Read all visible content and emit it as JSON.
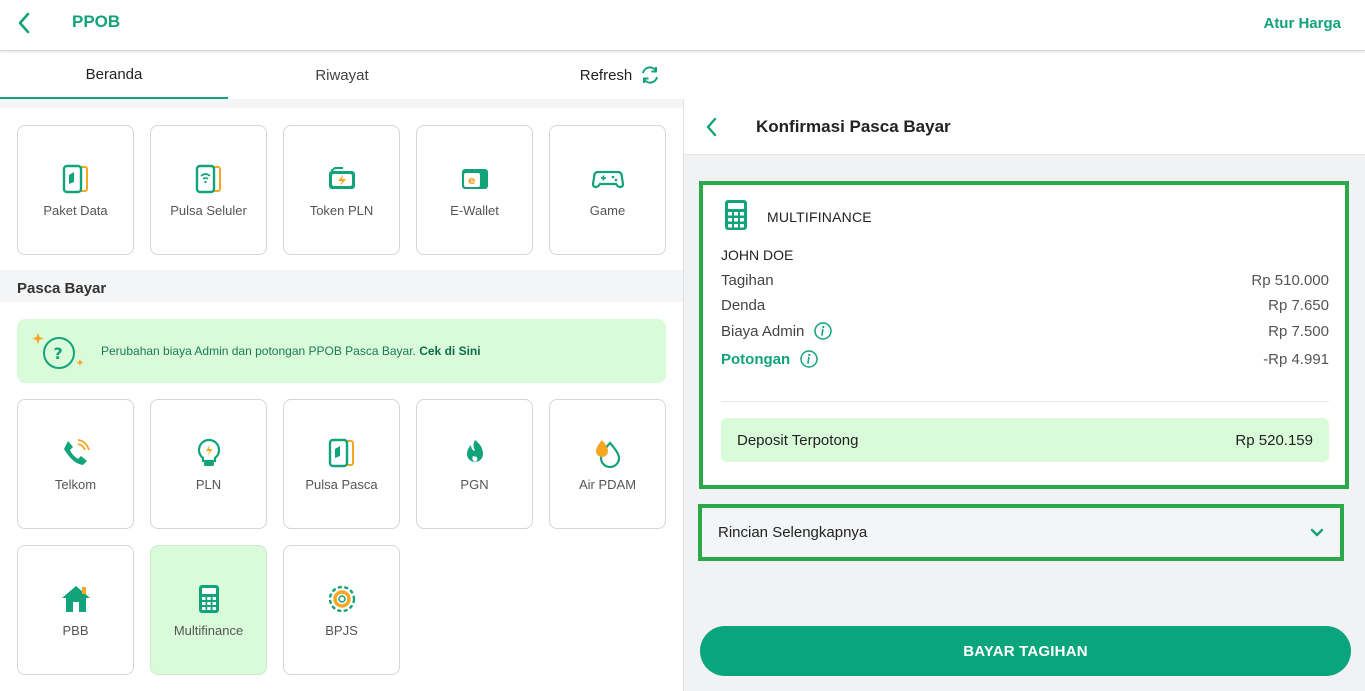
{
  "app": {
    "title": "PPOB",
    "action_label": "Atur Harga"
  },
  "tabs": [
    {
      "label": "Beranda",
      "active": true
    },
    {
      "label": "Riwayat",
      "active": false
    },
    {
      "label": "Refresh",
      "active": false
    }
  ],
  "prabayar": {
    "tiles": [
      {
        "label": "Paket Data",
        "icon": "paket-data-icon"
      },
      {
        "label": "Pulsa Seluler",
        "icon": "pulsa-seluler-icon"
      },
      {
        "label": "Token PLN",
        "icon": "token-pln-icon"
      },
      {
        "label": "E-Wallet",
        "icon": "e-wallet-icon"
      },
      {
        "label": "Game",
        "icon": "game-icon"
      }
    ]
  },
  "pascabayar": {
    "section_title": "Pasca Bayar",
    "banner": {
      "text": "Perubahan biaya Admin dan potongan PPOB Pasca Bayar. ",
      "link": "Cek di Sini"
    },
    "tiles": [
      {
        "label": "Telkom",
        "icon": "phone-icon"
      },
      {
        "label": "PLN",
        "icon": "lightbulb-icon"
      },
      {
        "label": "Pulsa Pasca",
        "icon": "pulsa-pasca-icon"
      },
      {
        "label": "PGN",
        "icon": "gas-icon"
      },
      {
        "label": "Air PDAM",
        "icon": "water-drop-icon"
      },
      {
        "label": "PBB",
        "icon": "house-icon"
      },
      {
        "label": "Multifinance",
        "icon": "calculator-icon",
        "selected": true
      },
      {
        "label": "BPJS",
        "icon": "bpjs-icon"
      }
    ]
  },
  "confirm": {
    "title": "Konfirmasi Pasca Bayar",
    "product": "MULTIFINANCE",
    "customer_name": "JOHN DOE",
    "rows": [
      {
        "label": "Tagihan",
        "value": "Rp 510.000"
      },
      {
        "label": "Denda",
        "value": "Rp 7.650"
      },
      {
        "label": "Biaya Admin",
        "value": "Rp 7.500"
      },
      {
        "label": "Potongan",
        "value": "-Rp 4.991"
      }
    ],
    "deposit_label": "Deposit Terpotong",
    "deposit_value": "Rp 520.159",
    "details_label": "Rincian Selengkapnya",
    "pay_button": "BAYAR TAGIHAN"
  },
  "colors": {
    "primary": "#12a37a",
    "button": "#0aa57d",
    "highlight_bg": "#d9fbd9",
    "outline": "#2aa84a",
    "accent_orange": "#f5a623"
  }
}
